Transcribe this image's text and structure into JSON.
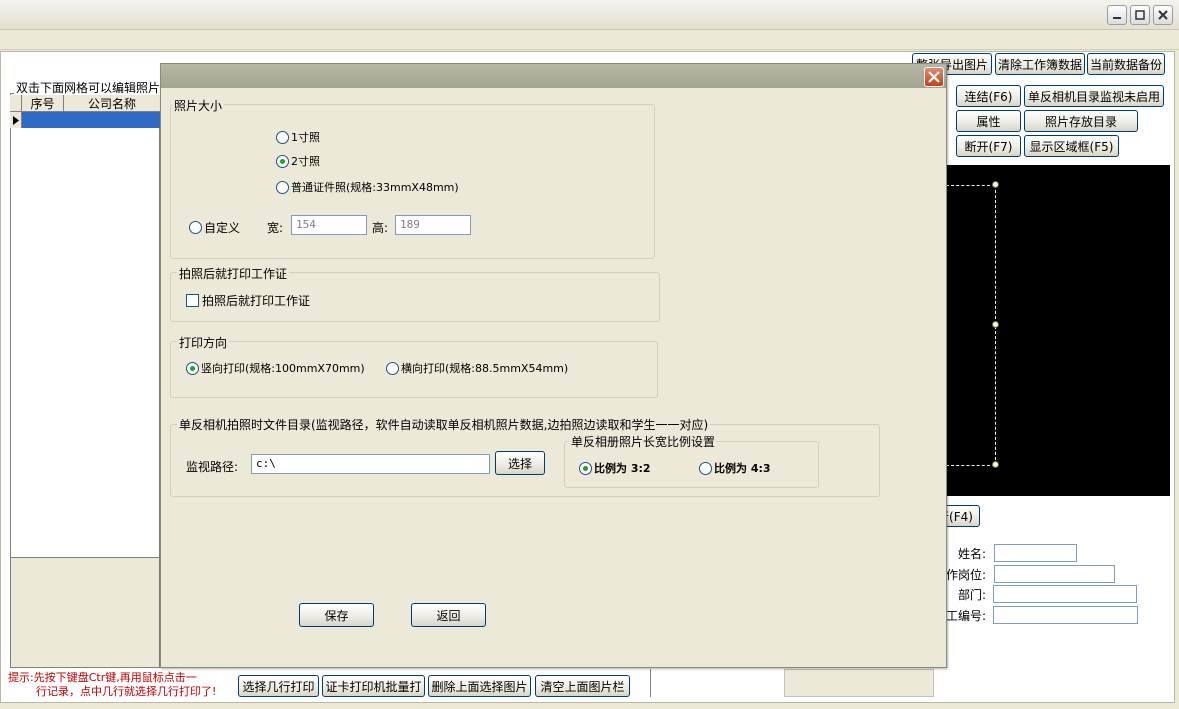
{
  "toolbar": {
    "export_photos": "整张导出图片",
    "clear_workbook": "清除工作簿数据",
    "backup_current": "当前数据备份"
  },
  "right_buttons": {
    "connect": "连结(F6)",
    "slr_monitor": "单反相机目录监视未启用",
    "properties": "属性",
    "photo_dir": "照片存放目录",
    "disconnect": "断开(F7)",
    "show_area": "显示区域框(F5)",
    "f4_button": "行(F4)"
  },
  "info_form": {
    "name_label": "姓名:",
    "position_label": "作岗位:",
    "department_label": "部门:",
    "employee_no_label": "工编号:"
  },
  "grid": {
    "group_label": "双击下面网格可以编辑照片",
    "columns": [
      "序号",
      "公司名称"
    ]
  },
  "hint": {
    "line1": "提示:先按下键盘Ctr键,再用鼠标点击一",
    "line2": "行记录，点中几行就选择几行打印了!"
  },
  "bottom_buttons": {
    "select_rows_print": "选择几行打印",
    "batch_print": "证卡打印机批量打",
    "delete_selected": "删除上面选择图片",
    "clear_photos": "清空上面图片栏"
  },
  "dialog": {
    "photo_size": {
      "legend": "照片大小",
      "opt_1inch": "1寸照",
      "opt_2inch": "2寸照",
      "opt_standard": "普通证件照(规格:33mmX48mm)",
      "opt_custom": "自定义",
      "width_label": "宽:",
      "width_value": "154",
      "height_label": "高:",
      "height_value": "189",
      "selected": "2寸照"
    },
    "print_after": {
      "legend": "拍照后就打印工作证",
      "checkbox_label": "拍照后就打印工作证",
      "checked": false
    },
    "print_direction": {
      "legend": "打印方向",
      "opt_portrait": "竖向打印(规格:100mmX70mm)",
      "opt_landscape": "横向打印(规格:88.5mmX54mm)",
      "selected": "竖向打印(规格:100mmX70mm)"
    },
    "monitor": {
      "legend": "单反相机拍照时文件目录(监视路径，软件自动读取单反相机照片数据,边拍照边读取和学生一一对应)",
      "path_label": "监视路径:",
      "path_value": "c:\\",
      "choose_button": "选择"
    },
    "ratio": {
      "legend": "单反相册照片长宽比例设置",
      "opt_3_2": "比例为 3:2",
      "opt_4_3": "比例为 4:3",
      "selected": "比例为 3:2"
    },
    "save_button": "保存",
    "back_button": "返回"
  }
}
